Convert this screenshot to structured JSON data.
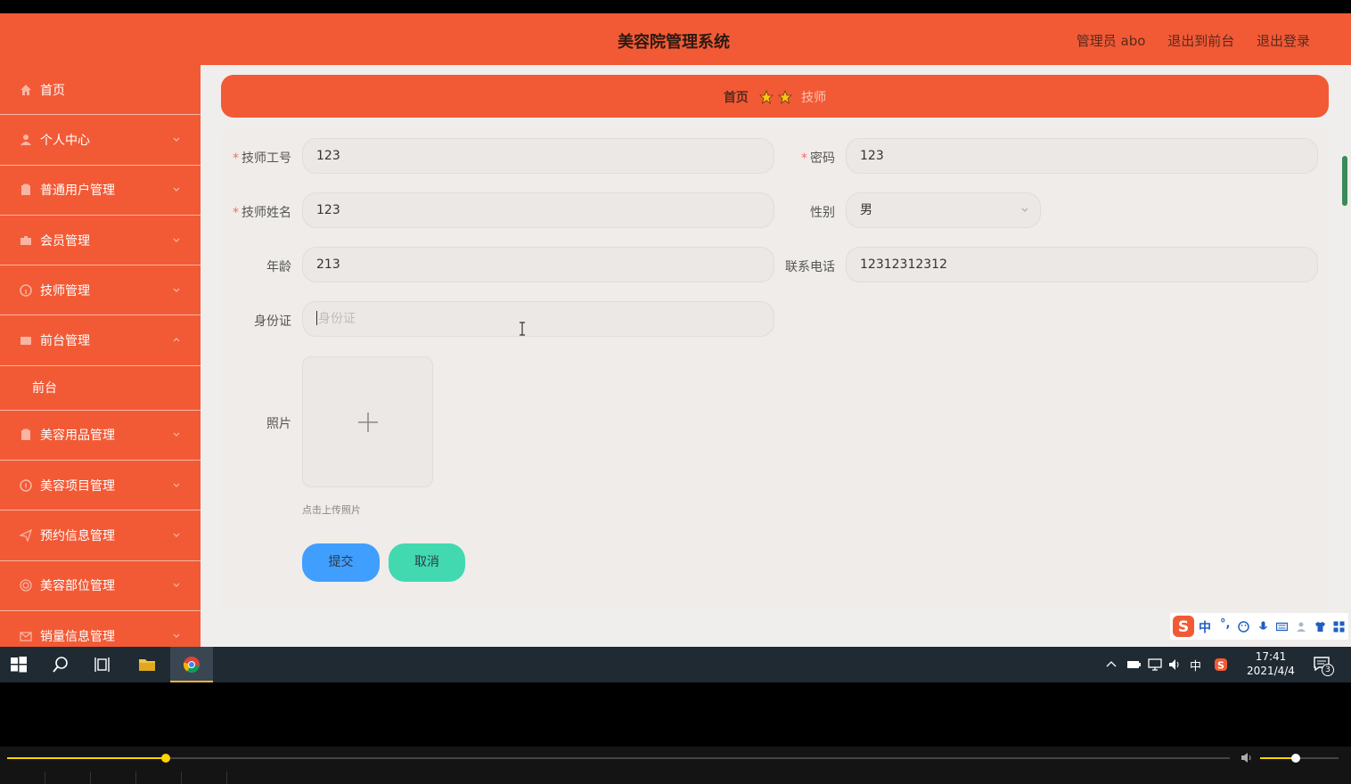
{
  "header": {
    "title": "美容院管理系统",
    "admin_label": "管理员 abo",
    "to_frontend": "退出到前台",
    "logout": "退出登录"
  },
  "sidebar": {
    "items": [
      {
        "label": "首页",
        "icon": "home-icon",
        "expandable": false
      },
      {
        "label": "个人中心",
        "icon": "user-icon",
        "expandable": true
      },
      {
        "label": "普通用户管理",
        "icon": "clipboard-icon",
        "expandable": true
      },
      {
        "label": "会员管理",
        "icon": "briefcase-icon",
        "expandable": true
      },
      {
        "label": "技师管理",
        "icon": "info-circle-icon",
        "expandable": true
      },
      {
        "label": "前台管理",
        "icon": "wallet-icon",
        "expandable": true,
        "expanded": true
      },
      {
        "label": "美容用品管理",
        "icon": "clipboard-icon",
        "expandable": true
      },
      {
        "label": "美容项目管理",
        "icon": "compass-icon",
        "expandable": true
      },
      {
        "label": "预约信息管理",
        "icon": "send-icon",
        "expandable": true
      },
      {
        "label": "美容部位管理",
        "icon": "target-icon",
        "expandable": true
      },
      {
        "label": "销量信息管理",
        "icon": "mail-icon",
        "expandable": true
      }
    ],
    "subitem_frontdesk": "前台"
  },
  "breadcrumb": {
    "home": "首页",
    "current": "技师"
  },
  "form": {
    "tech_id": {
      "label": "技师工号",
      "value": "123",
      "required": true
    },
    "password": {
      "label": "密码",
      "value": "123",
      "required": true
    },
    "tech_name": {
      "label": "技师姓名",
      "value": "123",
      "required": true
    },
    "gender": {
      "label": "性别",
      "value": "男"
    },
    "age": {
      "label": "年龄",
      "value": "213"
    },
    "phone": {
      "label": "联系电话",
      "value": "12312312312"
    },
    "id_card": {
      "label": "身份证",
      "placeholder": "身份证",
      "value": ""
    },
    "photo": {
      "label": "照片",
      "hint": "点击上传照片"
    },
    "submit": "提交",
    "cancel": "取消"
  },
  "ime": {
    "lang": "中",
    "punct": "°,"
  },
  "taskbar": {
    "clock_time": "17:41",
    "clock_date": "2021/4/4",
    "tray_lang": "中",
    "notification_count": "3"
  },
  "player": {
    "seek_fraction": 0.13,
    "volume_fraction": 0.45
  },
  "colors": {
    "brand": "#f25a36",
    "submit": "#409eff",
    "cancel": "#42d9b0",
    "required": "#f56c6c"
  }
}
